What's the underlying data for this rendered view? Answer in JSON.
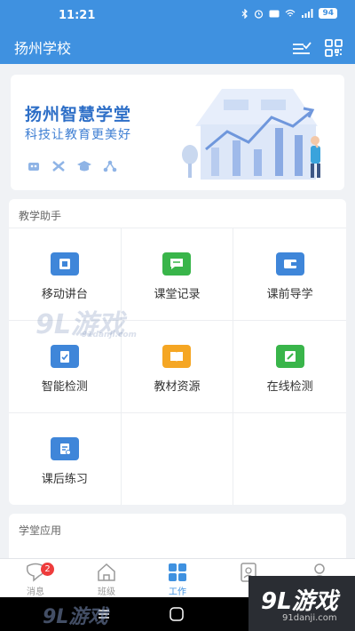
{
  "status_bar": {
    "time": "11:21",
    "battery": "94"
  },
  "header": {
    "title": "扬州学校"
  },
  "banner": {
    "title": "扬州智慧学堂",
    "subtitle": "科技让教育更美好"
  },
  "section_teaching": {
    "title": "教学助手",
    "items": [
      {
        "label": "移动讲台",
        "icon": "screen-icon",
        "color": "#3f86d9"
      },
      {
        "label": "课堂记录",
        "icon": "chat-icon",
        "color": "#39b54a"
      },
      {
        "label": "课前导学",
        "icon": "wallet-icon",
        "color": "#3f86d9"
      },
      {
        "label": "智能检测",
        "icon": "clipboard-icon",
        "color": "#3f86d9"
      },
      {
        "label": "教材资源",
        "icon": "book-icon",
        "color": "#f5a623"
      },
      {
        "label": "在线检测",
        "icon": "edit-icon",
        "color": "#39b54a"
      },
      {
        "label": "课后练习",
        "icon": "document-icon",
        "color": "#3f86d9"
      }
    ]
  },
  "section_apps": {
    "title": "学堂应用"
  },
  "tabs": [
    {
      "label": "消息",
      "badge": "2"
    },
    {
      "label": "班级"
    },
    {
      "label": "工作",
      "active": true
    },
    {
      "label": ""
    },
    {
      "label": ""
    }
  ],
  "watermarks": {
    "brand": "9L游戏",
    "site": "91danji.com"
  },
  "colors": {
    "primary": "#3f91e0",
    "background": "#f0f2f5"
  }
}
